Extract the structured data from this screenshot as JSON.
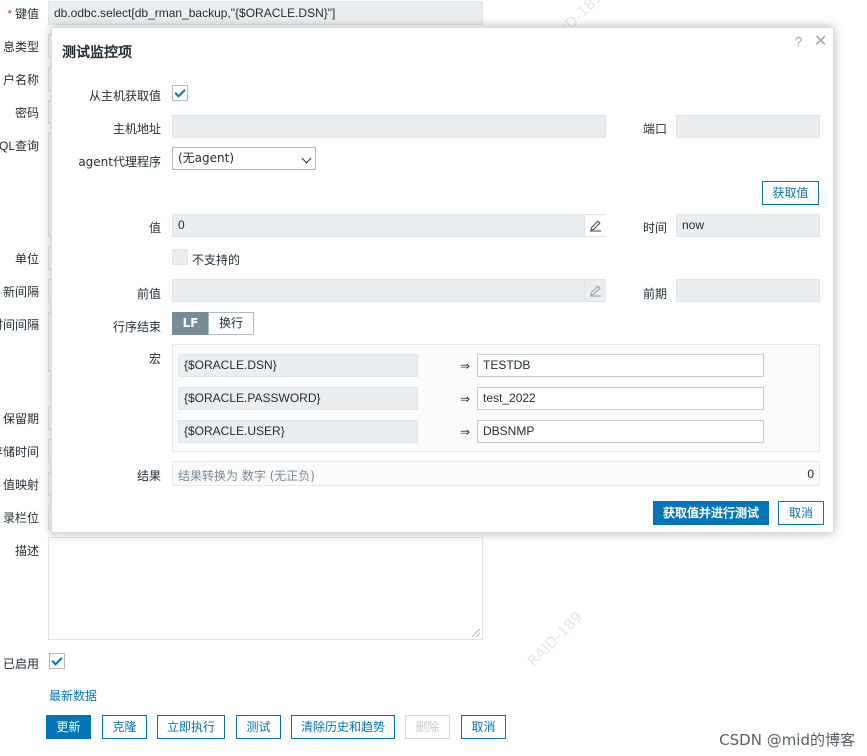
{
  "background_form": {
    "labels": [
      "键值",
      "信息类型",
      "用户名称",
      "密码",
      "SQL查询",
      "单位",
      "更新间隔",
      "时间间隔",
      "历史数据保留期",
      "趋势存储时间",
      "查看值映射",
      "填入主机资产记录栏位",
      "描述",
      "已启用"
    ],
    "labels_visible": [
      "键值",
      "息类型",
      "户名称",
      "密码",
      "QL查询",
      "单位",
      "新间隔",
      "时间间隔",
      "保留期",
      "存储时间",
      "值映射",
      "录栏位",
      "描述",
      "已启用"
    ],
    "key_required_marker": "*",
    "key_value": "db.odbc.select[db_rman_backup,\"{$ORACLE.DSN}\"]",
    "enabled_checked": true,
    "latest_data_link": "最新数据",
    "buttons": [
      "更新",
      "克隆",
      "立即执行",
      "测试",
      "清除历史和趋势",
      "删除",
      "取消"
    ]
  },
  "watermark": "RAID-189",
  "footer_credit": "CSDN @mid的博客",
  "modal": {
    "title": "测试监控项",
    "help": "?",
    "close": "✕",
    "get_from_host_label": "从主机获取值",
    "get_from_host_checked": true,
    "host_address_label": "主机地址",
    "host_address_value": "",
    "port_label": "端口",
    "port_value": "",
    "proxy_label": "agent代理程序",
    "proxy_selected": "(无agent)",
    "get_value_button": "获取值",
    "value_label": "值",
    "value": "0",
    "time_label": "时间",
    "time_value": "now",
    "not_supported_label": "不支持的",
    "prev_value_label": "前值",
    "prev_value": "",
    "prev_time_label": "前期",
    "prev_time_value": "",
    "eol_label": "行序结束",
    "eol_options": [
      "LF",
      "换行"
    ],
    "eol_selected": "LF",
    "macros_label": "宏",
    "macros": [
      {
        "name": "{$ORACLE.DSN}",
        "arrow": "⇒",
        "value": "TESTDB"
      },
      {
        "name": "{$ORACLE.PASSWORD}",
        "arrow": "⇒",
        "value": "test_2022"
      },
      {
        "name": "{$ORACLE.USER}",
        "arrow": "⇒",
        "value": "DBSNMP"
      }
    ],
    "result_label": "结果",
    "result_text": "结果转换为 数字 (无正负)",
    "result_value": "0",
    "test_button": "获取值并进行测试",
    "cancel_button": "取消"
  },
  "colors": {
    "accent": "#0275b8",
    "toggle_on": "#768d99",
    "readonly_field": "#ebeef0",
    "required": "#e33734"
  }
}
